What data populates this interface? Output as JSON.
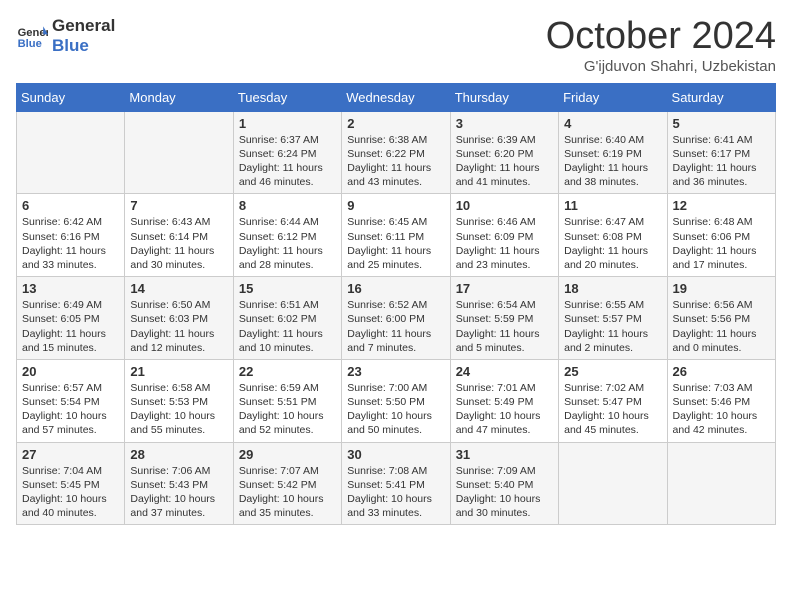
{
  "header": {
    "logo_line1": "General",
    "logo_line2": "Blue",
    "month": "October 2024",
    "location": "G'ijduvon Shahri, Uzbekistan"
  },
  "days_of_week": [
    "Sunday",
    "Monday",
    "Tuesday",
    "Wednesday",
    "Thursday",
    "Friday",
    "Saturday"
  ],
  "weeks": [
    [
      {
        "day": "",
        "info": ""
      },
      {
        "day": "",
        "info": ""
      },
      {
        "day": "1",
        "info": "Sunrise: 6:37 AM\nSunset: 6:24 PM\nDaylight: 11 hours and 46 minutes."
      },
      {
        "day": "2",
        "info": "Sunrise: 6:38 AM\nSunset: 6:22 PM\nDaylight: 11 hours and 43 minutes."
      },
      {
        "day": "3",
        "info": "Sunrise: 6:39 AM\nSunset: 6:20 PM\nDaylight: 11 hours and 41 minutes."
      },
      {
        "day": "4",
        "info": "Sunrise: 6:40 AM\nSunset: 6:19 PM\nDaylight: 11 hours and 38 minutes."
      },
      {
        "day": "5",
        "info": "Sunrise: 6:41 AM\nSunset: 6:17 PM\nDaylight: 11 hours and 36 minutes."
      }
    ],
    [
      {
        "day": "6",
        "info": "Sunrise: 6:42 AM\nSunset: 6:16 PM\nDaylight: 11 hours and 33 minutes."
      },
      {
        "day": "7",
        "info": "Sunrise: 6:43 AM\nSunset: 6:14 PM\nDaylight: 11 hours and 30 minutes."
      },
      {
        "day": "8",
        "info": "Sunrise: 6:44 AM\nSunset: 6:12 PM\nDaylight: 11 hours and 28 minutes."
      },
      {
        "day": "9",
        "info": "Sunrise: 6:45 AM\nSunset: 6:11 PM\nDaylight: 11 hours and 25 minutes."
      },
      {
        "day": "10",
        "info": "Sunrise: 6:46 AM\nSunset: 6:09 PM\nDaylight: 11 hours and 23 minutes."
      },
      {
        "day": "11",
        "info": "Sunrise: 6:47 AM\nSunset: 6:08 PM\nDaylight: 11 hours and 20 minutes."
      },
      {
        "day": "12",
        "info": "Sunrise: 6:48 AM\nSunset: 6:06 PM\nDaylight: 11 hours and 17 minutes."
      }
    ],
    [
      {
        "day": "13",
        "info": "Sunrise: 6:49 AM\nSunset: 6:05 PM\nDaylight: 11 hours and 15 minutes."
      },
      {
        "day": "14",
        "info": "Sunrise: 6:50 AM\nSunset: 6:03 PM\nDaylight: 11 hours and 12 minutes."
      },
      {
        "day": "15",
        "info": "Sunrise: 6:51 AM\nSunset: 6:02 PM\nDaylight: 11 hours and 10 minutes."
      },
      {
        "day": "16",
        "info": "Sunrise: 6:52 AM\nSunset: 6:00 PM\nDaylight: 11 hours and 7 minutes."
      },
      {
        "day": "17",
        "info": "Sunrise: 6:54 AM\nSunset: 5:59 PM\nDaylight: 11 hours and 5 minutes."
      },
      {
        "day": "18",
        "info": "Sunrise: 6:55 AM\nSunset: 5:57 PM\nDaylight: 11 hours and 2 minutes."
      },
      {
        "day": "19",
        "info": "Sunrise: 6:56 AM\nSunset: 5:56 PM\nDaylight: 11 hours and 0 minutes."
      }
    ],
    [
      {
        "day": "20",
        "info": "Sunrise: 6:57 AM\nSunset: 5:54 PM\nDaylight: 10 hours and 57 minutes."
      },
      {
        "day": "21",
        "info": "Sunrise: 6:58 AM\nSunset: 5:53 PM\nDaylight: 10 hours and 55 minutes."
      },
      {
        "day": "22",
        "info": "Sunrise: 6:59 AM\nSunset: 5:51 PM\nDaylight: 10 hours and 52 minutes."
      },
      {
        "day": "23",
        "info": "Sunrise: 7:00 AM\nSunset: 5:50 PM\nDaylight: 10 hours and 50 minutes."
      },
      {
        "day": "24",
        "info": "Sunrise: 7:01 AM\nSunset: 5:49 PM\nDaylight: 10 hours and 47 minutes."
      },
      {
        "day": "25",
        "info": "Sunrise: 7:02 AM\nSunset: 5:47 PM\nDaylight: 10 hours and 45 minutes."
      },
      {
        "day": "26",
        "info": "Sunrise: 7:03 AM\nSunset: 5:46 PM\nDaylight: 10 hours and 42 minutes."
      }
    ],
    [
      {
        "day": "27",
        "info": "Sunrise: 7:04 AM\nSunset: 5:45 PM\nDaylight: 10 hours and 40 minutes."
      },
      {
        "day": "28",
        "info": "Sunrise: 7:06 AM\nSunset: 5:43 PM\nDaylight: 10 hours and 37 minutes."
      },
      {
        "day": "29",
        "info": "Sunrise: 7:07 AM\nSunset: 5:42 PM\nDaylight: 10 hours and 35 minutes."
      },
      {
        "day": "30",
        "info": "Sunrise: 7:08 AM\nSunset: 5:41 PM\nDaylight: 10 hours and 33 minutes."
      },
      {
        "day": "31",
        "info": "Sunrise: 7:09 AM\nSunset: 5:40 PM\nDaylight: 10 hours and 30 minutes."
      },
      {
        "day": "",
        "info": ""
      },
      {
        "day": "",
        "info": ""
      }
    ]
  ]
}
